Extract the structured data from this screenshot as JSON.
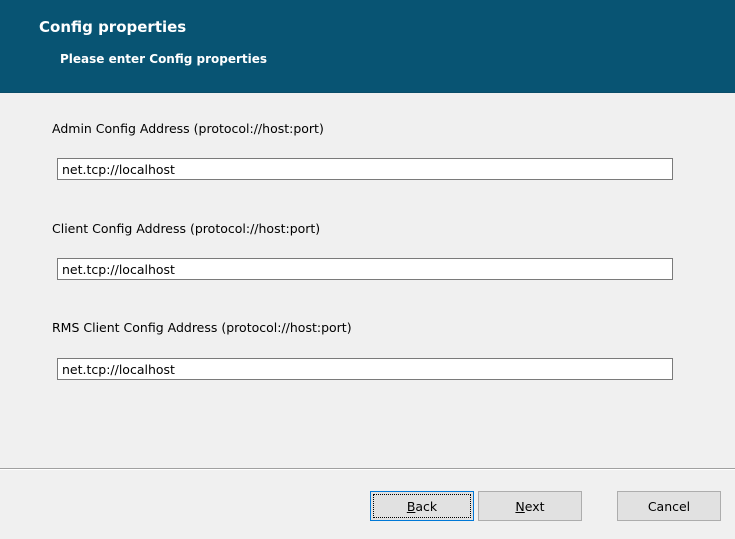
{
  "header": {
    "title": "Config properties",
    "subtitle": "Please enter Config properties"
  },
  "fields": [
    {
      "label": "Admin Config Address (protocol://host:port)",
      "value": "net.tcp://localhost"
    },
    {
      "label": "Client Config Address (protocol://host:port)",
      "value": "net.tcp://localhost"
    },
    {
      "label": "RMS Client Config Address (protocol://host:port)",
      "value": "net.tcp://localhost"
    }
  ],
  "buttons": {
    "back": {
      "mnemonic": "B",
      "rest": "ack"
    },
    "next": {
      "mnemonic": "N",
      "rest": "ext"
    },
    "cancel": "Cancel"
  },
  "colors": {
    "header_bg": "#085473",
    "header_text": "#ffffff",
    "dialog_bg": "#f0f0f0",
    "focus_border": "#0078d7"
  }
}
